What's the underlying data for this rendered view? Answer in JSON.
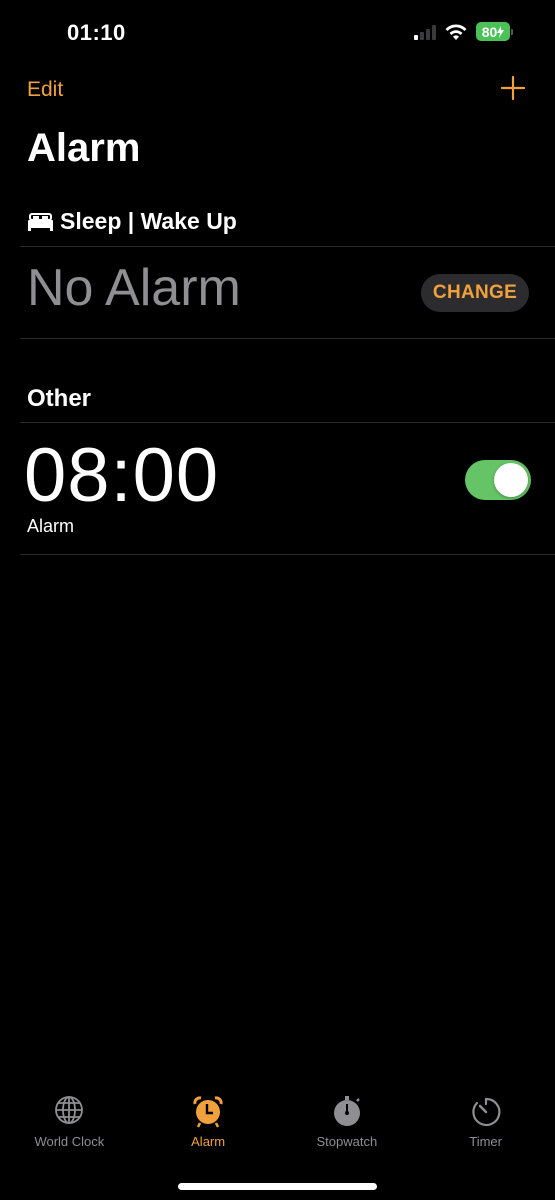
{
  "status_bar": {
    "time": "01:10",
    "signal_bars_active": 1,
    "signal_bars_total": 4,
    "wifi": "wifi-icon",
    "battery_percent": "80",
    "charging": true,
    "battery_color": "#4bc158"
  },
  "nav": {
    "edit_label": "Edit",
    "add_icon": "plus-icon"
  },
  "page_title": "Alarm",
  "sleep_section": {
    "icon": "bed-icon",
    "title": "Sleep | Wake Up",
    "status": "No Alarm",
    "change_label": "CHANGE"
  },
  "other_section": {
    "title": "Other",
    "alarms": [
      {
        "time": "08:00",
        "label": "Alarm",
        "enabled": true
      }
    ]
  },
  "tab_bar": {
    "tabs": [
      {
        "label": "World Clock",
        "icon": "globe-icon",
        "active": false
      },
      {
        "label": "Alarm",
        "icon": "alarm-clock-icon",
        "active": true
      },
      {
        "label": "Stopwatch",
        "icon": "stopwatch-icon",
        "active": false
      },
      {
        "label": "Timer",
        "icon": "timer-icon",
        "active": false
      }
    ]
  },
  "colors": {
    "accent": "#f0a03c",
    "toggle_on": "#65c466",
    "inactive": "#8e8e93",
    "background": "#000000"
  }
}
